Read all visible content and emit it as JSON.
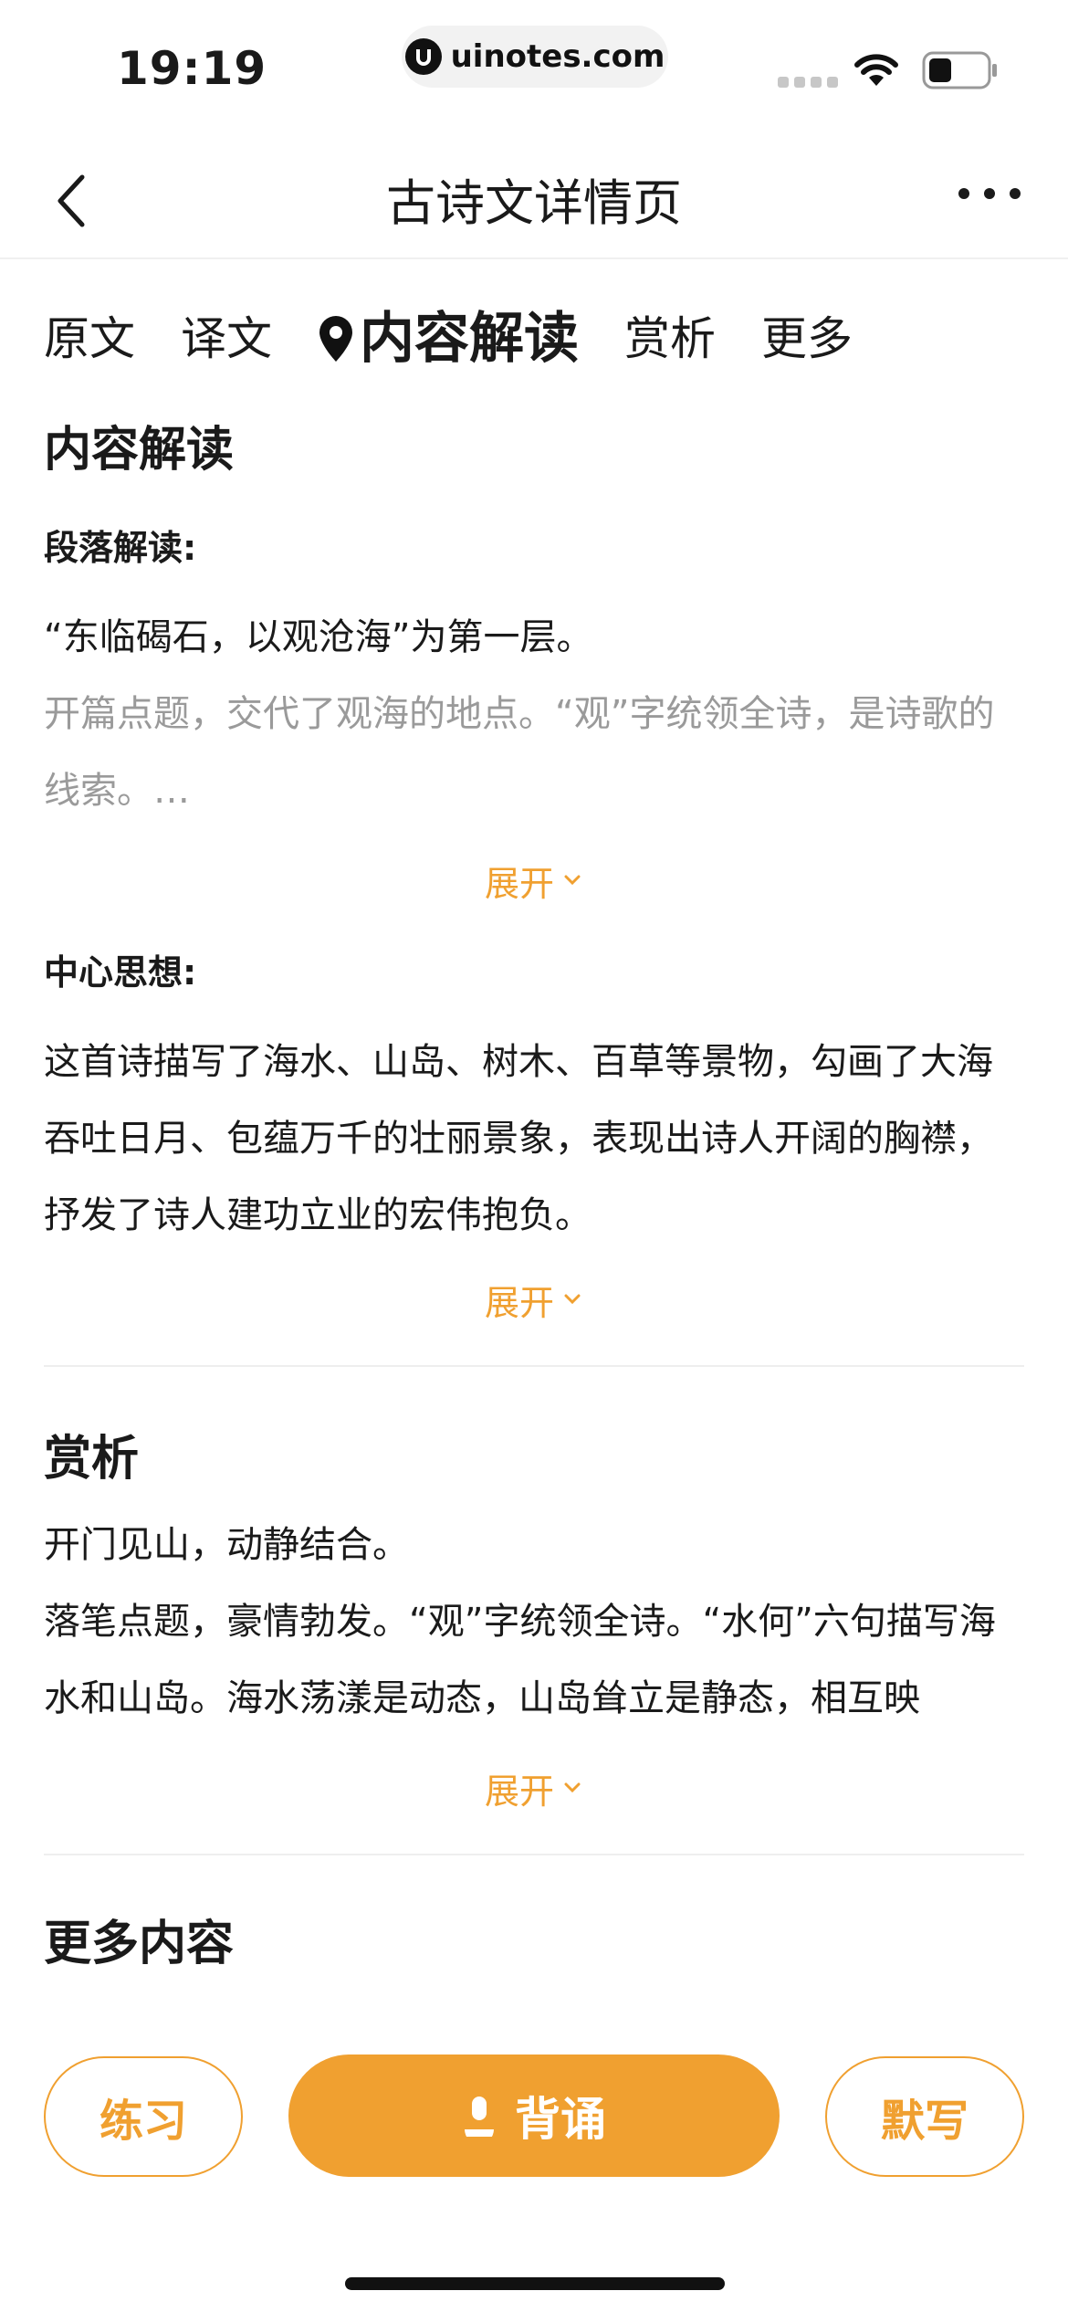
{
  "status_bar": {
    "time": "19:19",
    "url": "uinotes.com"
  },
  "nav": {
    "title": "古诗文详情页"
  },
  "tabs": [
    {
      "label": "原文"
    },
    {
      "label": "译文"
    },
    {
      "label": "内容解读",
      "active": true
    },
    {
      "label": "赏析"
    },
    {
      "label": "更多"
    }
  ],
  "reading": {
    "title": "内容解读",
    "paragraph_section": {
      "heading": "段落解读:",
      "line1": "“东临碣石，以观沧海”为第一层。",
      "line2": "开篇点题，交代了观海的地点。“观”字统领全诗，是诗歌的线索。…",
      "expand": "展开"
    },
    "theme_section": {
      "heading": "中心思想:",
      "text": "这首诗描写了海水、山岛、树木、百草等景物，勾画了大海吞吐日月、包蕴万千的壮丽景象，表现出诗人开阔的胸襟，抒发了诗人建功立业的宏伟抱负。",
      "expand": "展开"
    }
  },
  "appreciation": {
    "title": "赏析",
    "line1": "开门见山，动静结合。",
    "line2": "落笔点题，豪情勃发。“观”字统领全诗。“水何”六句描写海水和山岛。海水荡漾是动态，山岛耸立是静态，相互映",
    "expand": "展开"
  },
  "more_section": {
    "title": "更多内容"
  },
  "bottom_bar": {
    "practice": "练习",
    "recite": "背诵",
    "dictate": "默写"
  },
  "colors": {
    "accent": "#f0a030",
    "grey_text": "#9a9a9a"
  }
}
